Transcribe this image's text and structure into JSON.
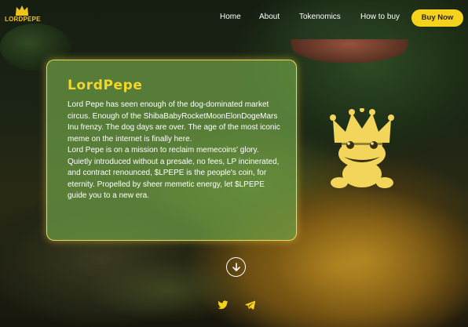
{
  "brand": {
    "name": "LORDPEPE"
  },
  "nav": {
    "items": [
      "Home",
      "About",
      "Tokenomics",
      "How to buy"
    ],
    "buy_label": "Buy Now"
  },
  "hero": {
    "title": "LordPepe",
    "paragraph1": "Lord Pepe has seen enough of the dog-dominated market circus. Enough of the ShibaBabyRocketMoonElonDogeMars Inu frenzy. The dog days are over. The age of the most iconic meme on the internet is finally here.",
    "paragraph2": "Lord Pepe is on a mission to reclaim memecoins' glory. Quietly introduced without a presale, no fees, LP incinerated, and contract renounced, $LPEPE is the people's coin, for eternity. Propelled by sheer memetic energy, let $LPEPE guide you to a new era."
  },
  "icons": {
    "logo": "crown-icon",
    "mascot": "crowned-frog-icon",
    "scroll": "arrow-down-circle-icon",
    "social": [
      "twitter-icon",
      "telegram-icon"
    ]
  },
  "colors": {
    "accent": "#f5d21c",
    "card_bg": "#6ea046",
    "card_border": "#f5dc5a"
  }
}
